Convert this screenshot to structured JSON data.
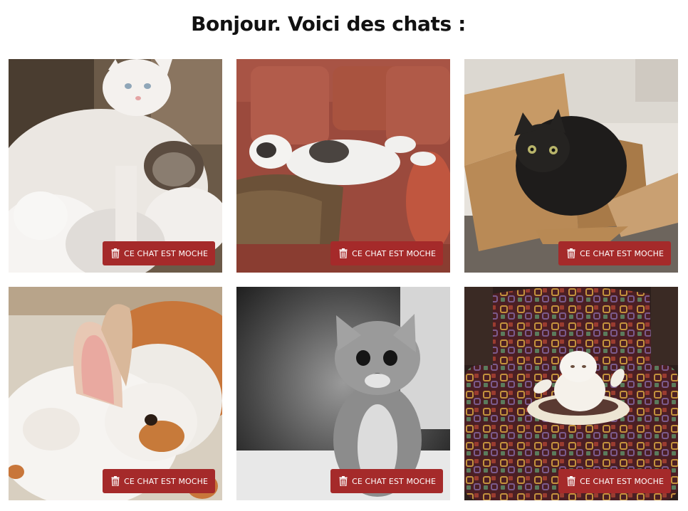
{
  "page": {
    "title": "Bonjour. Voici des chats :"
  },
  "cats": [
    {
      "button_label": "CE CHAT EST MOCHE",
      "icon": "trash-icon",
      "photo": "white-cat-with-kittens"
    },
    {
      "button_label": "CE CHAT EST MOCHE",
      "icon": "trash-icon",
      "photo": "cat-lying-on-red-couch"
    },
    {
      "button_label": "CE CHAT EST MOCHE",
      "icon": "trash-icon",
      "photo": "black-cat-in-cardboard-box"
    },
    {
      "button_label": "CE CHAT EST MOCHE",
      "icon": "trash-icon",
      "photo": "cat-with-rabbit"
    },
    {
      "button_label": "CE CHAT EST MOCHE",
      "icon": "trash-icon",
      "photo": "grey-kitten-black-and-white"
    },
    {
      "button_label": "CE CHAT EST MOCHE",
      "icon": "trash-icon",
      "photo": "cat-on-patterned-armchair"
    }
  ],
  "colors": {
    "button_bg": "#a52a2a",
    "button_text": "#ffffff"
  }
}
